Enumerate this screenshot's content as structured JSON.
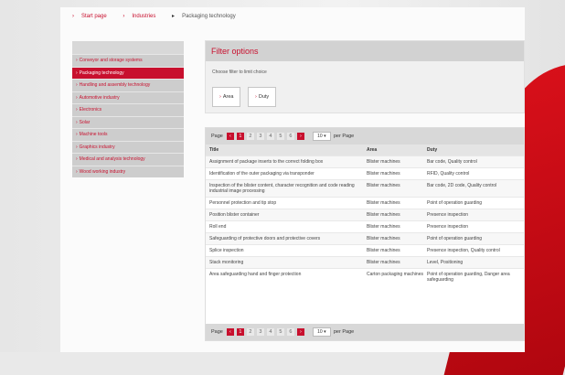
{
  "breadcrumb": {
    "items": [
      "Start page",
      "Industries",
      "Packaging technology"
    ]
  },
  "sidebar": {
    "items": [
      {
        "label": "Conveyor and storage systems",
        "active": false
      },
      {
        "label": "Packaging technology",
        "active": true
      },
      {
        "label": "Handling and assembly technology",
        "active": false
      },
      {
        "label": "Automotive industry",
        "active": false
      },
      {
        "label": "Electronics",
        "active": false
      },
      {
        "label": "Solar",
        "active": false
      },
      {
        "label": "Machine tools",
        "active": false
      },
      {
        "label": "Graphics industry",
        "active": false
      },
      {
        "label": "Medical and analysis technology",
        "active": false
      },
      {
        "label": "Wood working industry",
        "active": false
      }
    ]
  },
  "filter": {
    "title": "Filter options",
    "hint": "Choose filter to limit choice",
    "buttons": [
      {
        "label": "Area"
      },
      {
        "label": "Duty"
      }
    ]
  },
  "pager": {
    "label": "Page",
    "pages": [
      "1",
      "2",
      "3",
      "4",
      "5",
      "6"
    ],
    "current": "1",
    "per_page": "10",
    "per_page_suffix": "per Page"
  },
  "table": {
    "columns": [
      "Title",
      "Area",
      "Duty"
    ],
    "rows": [
      [
        "Assignment of package inserts to the correct folding box",
        "Blister machines",
        "Bar code, Quality control"
      ],
      [
        "Identification of the outer packaging via transponder",
        "Blister machines",
        "RFID, Quality control"
      ],
      [
        "Inspection of the blister content, character recognition and code reading industrial image processing",
        "Blister machines",
        "Bar code, 2D code, Quality control"
      ],
      [
        "Personnel protection and tip stop",
        "Blister machines",
        "Point of operation guarding"
      ],
      [
        "Position blister container",
        "Blister machines",
        "Presence inspection"
      ],
      [
        "Roll end",
        "Blister machines",
        "Presence inspection"
      ],
      [
        "Safeguarding of protective doors and protective covers",
        "Blister machines",
        "Point of operation guarding"
      ],
      [
        "Splice inspection",
        "Blister machines",
        "Presence inspection, Quality control"
      ],
      [
        "Stack monitoring",
        "Blister machines",
        "Level, Positioning"
      ],
      [
        "Area safeguarding hand and finger protection",
        "Carton packaging machines",
        "Point of operation guarding, Danger area safeguarding"
      ]
    ]
  },
  "colors": {
    "accent": "#c8102e",
    "panel": "#d8d8d8"
  }
}
